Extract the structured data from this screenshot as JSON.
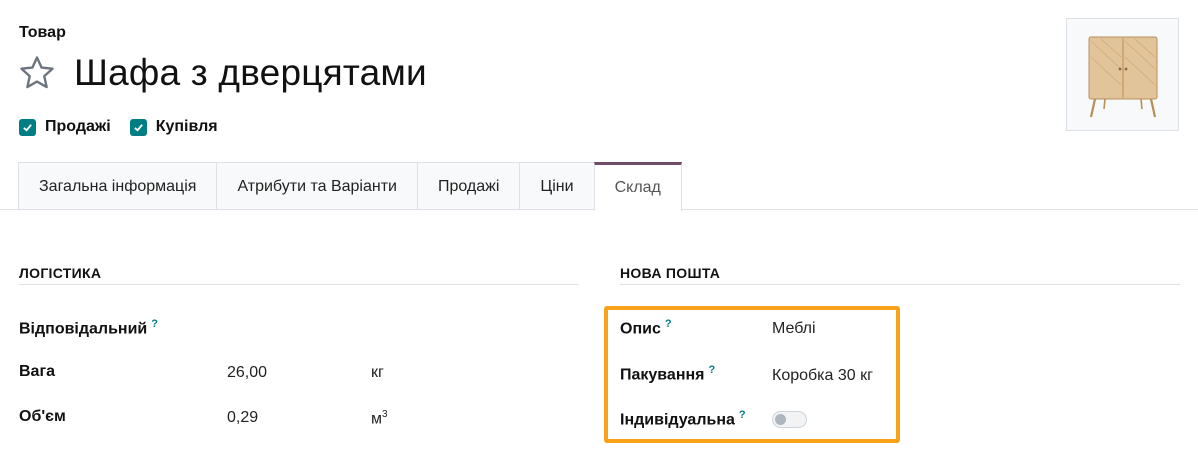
{
  "record": {
    "type_label": "Товар",
    "product_name": "Шафа з дверцятами"
  },
  "flags": [
    {
      "label": "Продажі",
      "checked": true
    },
    {
      "label": "Купівля",
      "checked": true
    }
  ],
  "tabs": [
    {
      "label": "Загальна інформація",
      "active": false
    },
    {
      "label": "Атрибути та Варіанти",
      "active": false
    },
    {
      "label": "Продажі",
      "active": false
    },
    {
      "label": "Ціни",
      "active": false
    },
    {
      "label": "Склад",
      "active": true
    }
  ],
  "logistics": {
    "title": "ЛОГІСТИКА",
    "responsible": {
      "label": "Відповідальний",
      "help": "?",
      "value": ""
    },
    "weight": {
      "label": "Вага",
      "value": "26,00",
      "unit": "кг"
    },
    "volume": {
      "label": "Об'єм",
      "value": "0,29",
      "unit": "м",
      "unit_exp": "3"
    }
  },
  "nova_poshta": {
    "title": "НОВА ПОШТА",
    "description": {
      "label": "Опис",
      "help": "?",
      "value": "Меблі"
    },
    "packaging": {
      "label": "Пакування",
      "help": "?",
      "value": "Коробка 30 кг"
    },
    "individual": {
      "label": "Індивідуальна",
      "help": "?",
      "enabled": false
    }
  },
  "colors": {
    "accent": "#017e84",
    "tab_active": "#714b67",
    "highlight": "#f7a21b"
  },
  "icons": {
    "favorite": "star-icon",
    "checkbox": "checkmark-icon",
    "product_image": "cabinet-image"
  }
}
